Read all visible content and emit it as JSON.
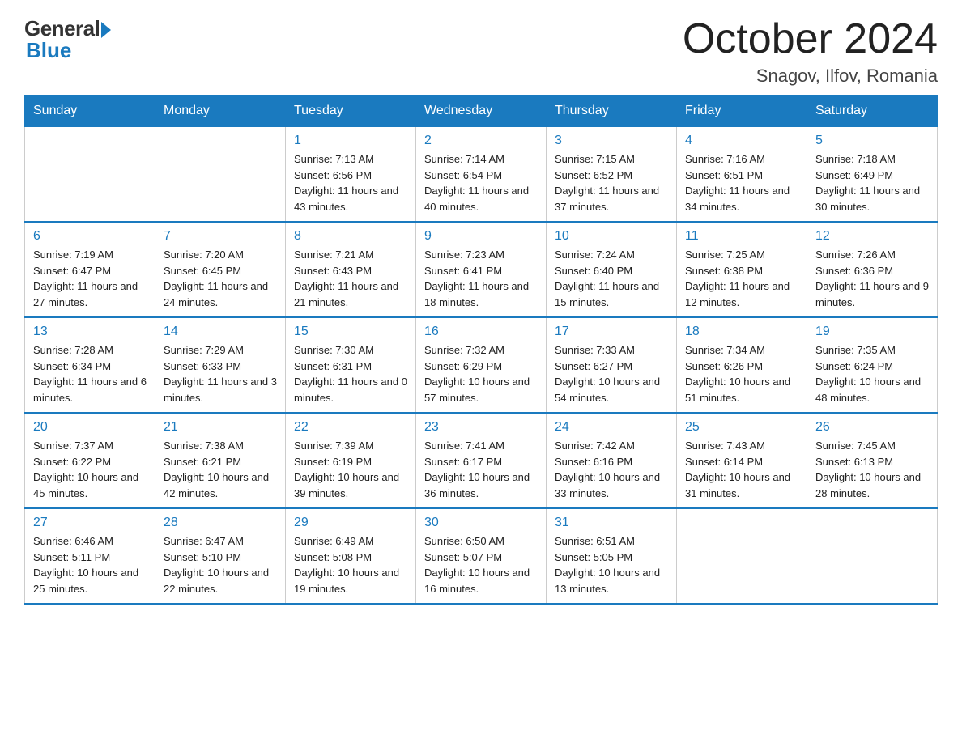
{
  "header": {
    "logo_general": "General",
    "logo_blue": "Blue",
    "month_title": "October 2024",
    "subtitle": "Snagov, Ilfov, Romania"
  },
  "weekdays": [
    "Sunday",
    "Monday",
    "Tuesday",
    "Wednesday",
    "Thursday",
    "Friday",
    "Saturday"
  ],
  "weeks": [
    [
      {
        "day": "",
        "info": ""
      },
      {
        "day": "",
        "info": ""
      },
      {
        "day": "1",
        "info": "Sunrise: 7:13 AM\nSunset: 6:56 PM\nDaylight: 11 hours\nand 43 minutes."
      },
      {
        "day": "2",
        "info": "Sunrise: 7:14 AM\nSunset: 6:54 PM\nDaylight: 11 hours\nand 40 minutes."
      },
      {
        "day": "3",
        "info": "Sunrise: 7:15 AM\nSunset: 6:52 PM\nDaylight: 11 hours\nand 37 minutes."
      },
      {
        "day": "4",
        "info": "Sunrise: 7:16 AM\nSunset: 6:51 PM\nDaylight: 11 hours\nand 34 minutes."
      },
      {
        "day": "5",
        "info": "Sunrise: 7:18 AM\nSunset: 6:49 PM\nDaylight: 11 hours\nand 30 minutes."
      }
    ],
    [
      {
        "day": "6",
        "info": "Sunrise: 7:19 AM\nSunset: 6:47 PM\nDaylight: 11 hours\nand 27 minutes."
      },
      {
        "day": "7",
        "info": "Sunrise: 7:20 AM\nSunset: 6:45 PM\nDaylight: 11 hours\nand 24 minutes."
      },
      {
        "day": "8",
        "info": "Sunrise: 7:21 AM\nSunset: 6:43 PM\nDaylight: 11 hours\nand 21 minutes."
      },
      {
        "day": "9",
        "info": "Sunrise: 7:23 AM\nSunset: 6:41 PM\nDaylight: 11 hours\nand 18 minutes."
      },
      {
        "day": "10",
        "info": "Sunrise: 7:24 AM\nSunset: 6:40 PM\nDaylight: 11 hours\nand 15 minutes."
      },
      {
        "day": "11",
        "info": "Sunrise: 7:25 AM\nSunset: 6:38 PM\nDaylight: 11 hours\nand 12 minutes."
      },
      {
        "day": "12",
        "info": "Sunrise: 7:26 AM\nSunset: 6:36 PM\nDaylight: 11 hours\nand 9 minutes."
      }
    ],
    [
      {
        "day": "13",
        "info": "Sunrise: 7:28 AM\nSunset: 6:34 PM\nDaylight: 11 hours\nand 6 minutes."
      },
      {
        "day": "14",
        "info": "Sunrise: 7:29 AM\nSunset: 6:33 PM\nDaylight: 11 hours\nand 3 minutes."
      },
      {
        "day": "15",
        "info": "Sunrise: 7:30 AM\nSunset: 6:31 PM\nDaylight: 11 hours\nand 0 minutes."
      },
      {
        "day": "16",
        "info": "Sunrise: 7:32 AM\nSunset: 6:29 PM\nDaylight: 10 hours\nand 57 minutes."
      },
      {
        "day": "17",
        "info": "Sunrise: 7:33 AM\nSunset: 6:27 PM\nDaylight: 10 hours\nand 54 minutes."
      },
      {
        "day": "18",
        "info": "Sunrise: 7:34 AM\nSunset: 6:26 PM\nDaylight: 10 hours\nand 51 minutes."
      },
      {
        "day": "19",
        "info": "Sunrise: 7:35 AM\nSunset: 6:24 PM\nDaylight: 10 hours\nand 48 minutes."
      }
    ],
    [
      {
        "day": "20",
        "info": "Sunrise: 7:37 AM\nSunset: 6:22 PM\nDaylight: 10 hours\nand 45 minutes."
      },
      {
        "day": "21",
        "info": "Sunrise: 7:38 AM\nSunset: 6:21 PM\nDaylight: 10 hours\nand 42 minutes."
      },
      {
        "day": "22",
        "info": "Sunrise: 7:39 AM\nSunset: 6:19 PM\nDaylight: 10 hours\nand 39 minutes."
      },
      {
        "day": "23",
        "info": "Sunrise: 7:41 AM\nSunset: 6:17 PM\nDaylight: 10 hours\nand 36 minutes."
      },
      {
        "day": "24",
        "info": "Sunrise: 7:42 AM\nSunset: 6:16 PM\nDaylight: 10 hours\nand 33 minutes."
      },
      {
        "day": "25",
        "info": "Sunrise: 7:43 AM\nSunset: 6:14 PM\nDaylight: 10 hours\nand 31 minutes."
      },
      {
        "day": "26",
        "info": "Sunrise: 7:45 AM\nSunset: 6:13 PM\nDaylight: 10 hours\nand 28 minutes."
      }
    ],
    [
      {
        "day": "27",
        "info": "Sunrise: 6:46 AM\nSunset: 5:11 PM\nDaylight: 10 hours\nand 25 minutes."
      },
      {
        "day": "28",
        "info": "Sunrise: 6:47 AM\nSunset: 5:10 PM\nDaylight: 10 hours\nand 22 minutes."
      },
      {
        "day": "29",
        "info": "Sunrise: 6:49 AM\nSunset: 5:08 PM\nDaylight: 10 hours\nand 19 minutes."
      },
      {
        "day": "30",
        "info": "Sunrise: 6:50 AM\nSunset: 5:07 PM\nDaylight: 10 hours\nand 16 minutes."
      },
      {
        "day": "31",
        "info": "Sunrise: 6:51 AM\nSunset: 5:05 PM\nDaylight: 10 hours\nand 13 minutes."
      },
      {
        "day": "",
        "info": ""
      },
      {
        "day": "",
        "info": ""
      }
    ]
  ]
}
